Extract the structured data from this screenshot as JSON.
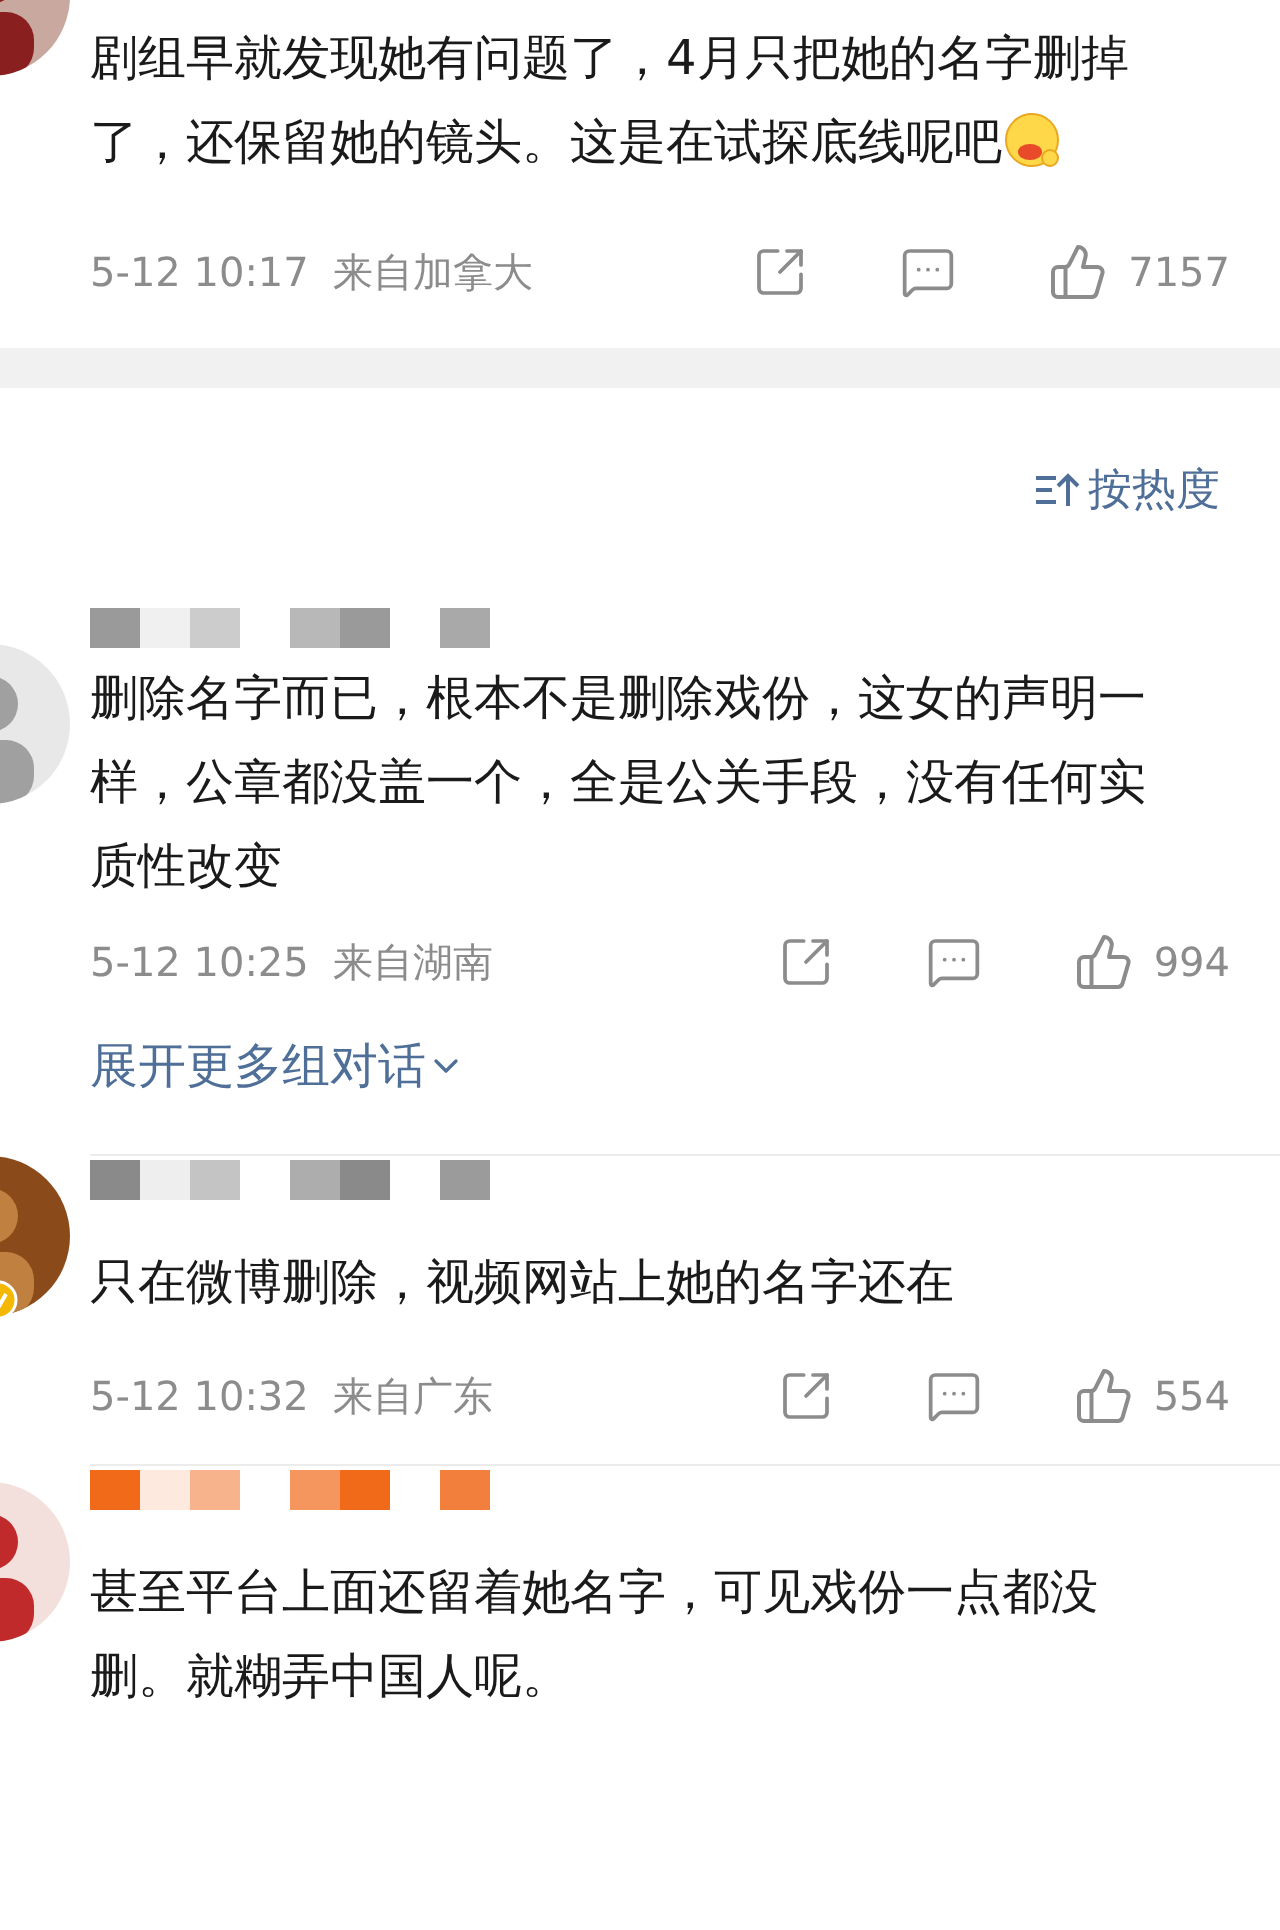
{
  "comments": [
    {
      "text": "剧组早就发现她有问题了，4月只把她的名字删掉了，还保留她的镜头。这是在试探底线呢吧",
      "emoji": true,
      "meta": {
        "time": "5-12 10:17",
        "location": "来自加拿大",
        "likes": "7157"
      }
    },
    {
      "color": "#9a9a9a",
      "text": "删除名字而已，根本不是删除戏份，这女的声明一样，公章都没盖一个，全是公关手段，没有任何实质性改变",
      "meta": {
        "time": "5-12 10:25",
        "location": "来自湖南",
        "likes": "994"
      },
      "expand_link": "展开更多组对话"
    },
    {
      "verified": true,
      "color": "#8a8a8a",
      "text": "只在微博删除，视频网站上她的名字还在",
      "meta": {
        "time": "5-12 10:32",
        "location": "来自广东",
        "likes": "554"
      }
    },
    {
      "color": "#f06a1a",
      "text": "甚至平台上面还留着她名字，可见戏份一点都没删。就糊弄中国人呢。"
    }
  ],
  "sort": {
    "label": "按热度"
  }
}
